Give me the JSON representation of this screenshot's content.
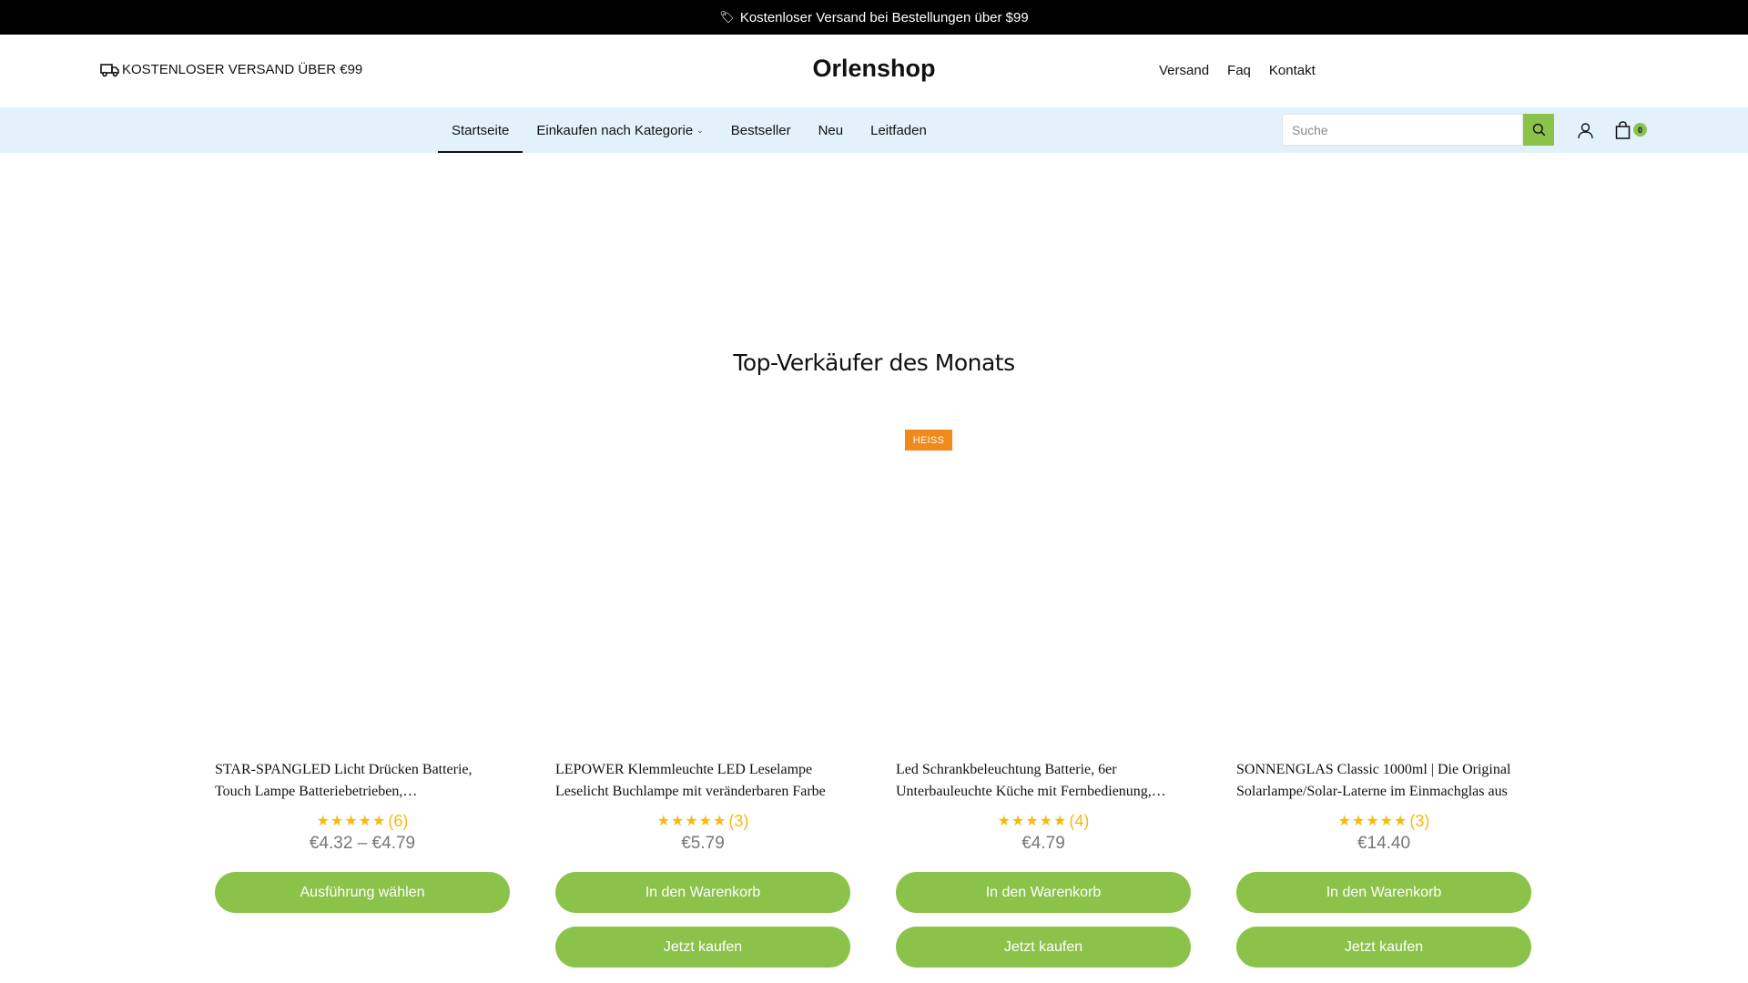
{
  "announcement": {
    "icon": "tag-icon",
    "text": "Kostenloser Versand bei Bestellungen über $99"
  },
  "header": {
    "shipping_icon": "truck-icon",
    "shipping_text": "KOSTENLOSER VERSAND ÜBER €99",
    "brand": "Orlenshop",
    "links": [
      "Versand",
      "Faq",
      "Kontakt"
    ]
  },
  "nav": {
    "items": [
      {
        "label": "Startseite"
      },
      {
        "label": "Einkaufen nach Kategorie",
        "chevron": "⌄"
      },
      {
        "label": "Bestseller"
      },
      {
        "label": "Neu"
      },
      {
        "label": "Leitfaden"
      }
    ],
    "search_placeholder": "Suche",
    "cart_count": "0"
  },
  "section": {
    "title": "Top-Verkäufer des Monats",
    "badge": "HEISS"
  },
  "products": [
    {
      "title": "STAR-SPANGLED Licht Drücken Batterie, Touch Lampe Batteriebetrieben, Schrankbeleuchtung",
      "stars": "★★★★★",
      "reviews": "(6)",
      "price": "€4.32 – €4.79",
      "primary_button": "Ausführung wählen",
      "secondary_button": ""
    },
    {
      "title": "LEPOWER Klemmleuchte LED Leselampe Leselicht Buchlampe mit veränderbaren Farbe",
      "stars": "★★★★★",
      "reviews": "(3)",
      "price": "€5.79",
      "primary_button": "In den Warenkorb",
      "secondary_button": "Jetzt kaufen"
    },
    {
      "title": "Led Schrankbeleuchtung Batterie, 6er Unterbauleuchte Küche mit Fernbedienung, Kabellos",
      "stars": "★★★★★",
      "reviews": "(4)",
      "price": "€4.79",
      "primary_button": "In den Warenkorb",
      "secondary_button": "Jetzt kaufen"
    },
    {
      "title": "SONNENGLAS Classic 1000ml | Die Original Solarlampe/Solar-Laterne im Einmachglas aus",
      "stars": "★★★★★",
      "reviews": "(3)",
      "price": "€14.40",
      "primary_button": "In den Warenkorb",
      "secondary_button": "Jetzt kaufen"
    }
  ],
  "colors": {
    "accent_green": "#8bc34a",
    "nav_bg": "#e3f1fb",
    "badge_orange": "#f08a1c",
    "star_yellow": "#f6b90f"
  }
}
